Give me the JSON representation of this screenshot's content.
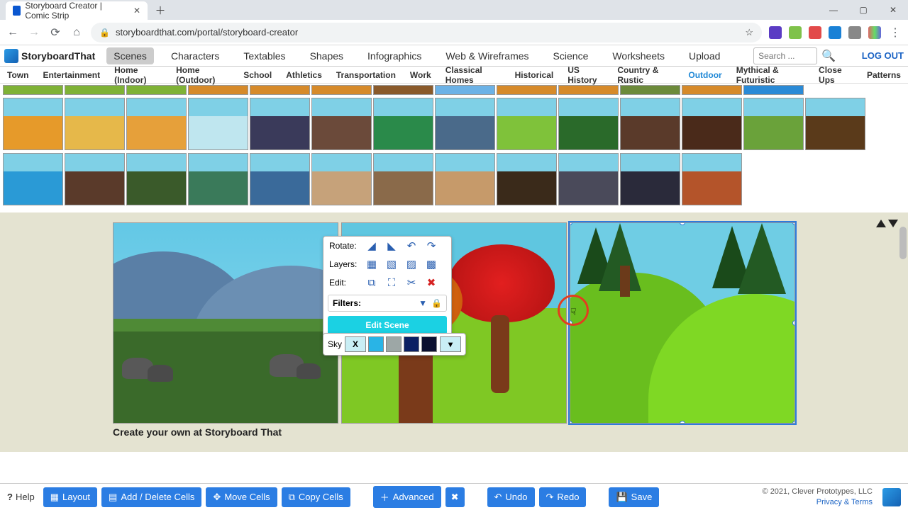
{
  "browser": {
    "tab_title": "Storyboard Creator | Comic Strip",
    "url": "storyboardthat.com/portal/storyboard-creator"
  },
  "header": {
    "logo_text": "StoryboardThat",
    "tabs": [
      "Scenes",
      "Characters",
      "Textables",
      "Shapes",
      "Infographics",
      "Web & Wireframes",
      "Science",
      "Worksheets",
      "Upload"
    ],
    "selected_tab": "Scenes",
    "search_placeholder": "Search ...",
    "logout": "LOG OUT"
  },
  "subtabs": {
    "items": [
      "Town",
      "Entertainment",
      "Home (Indoor)",
      "Home (Outdoor)",
      "School",
      "Athletics",
      "Transportation",
      "Work",
      "Classical Homes",
      "Historical",
      "US History",
      "Country & Rustic",
      "Outdoor",
      "Mythical & Futuristic",
      "Close Ups",
      "Patterns"
    ],
    "selected": "Outdoor"
  },
  "panel": {
    "rotate_label": "Rotate:",
    "layers_label": "Layers:",
    "edit_label": "Edit:",
    "filters_label": "Filters:",
    "edit_scene": "Edit Scene"
  },
  "sky_panel": {
    "label": "Sky",
    "selected_marker": "X",
    "swatches": [
      "#c9eef5",
      "#29b4e6",
      "#9da7a6",
      "#0b1f63",
      "#0b1030"
    ],
    "current": "#c9eef5"
  },
  "caption": "Create your own at Storyboard That",
  "toolbar": {
    "help": "Help",
    "layout": "Layout",
    "add_delete": "Add / Delete Cells",
    "move": "Move Cells",
    "copy": "Copy Cells",
    "advanced": "Advanced",
    "undo": "Undo",
    "redo": "Redo",
    "save": "Save"
  },
  "footer": {
    "copyright": "© 2021, Clever Prototypes, LLC",
    "privacy": "Privacy & Terms"
  },
  "thumb_colors": [
    [
      "#7fb236",
      "#7fb236",
      "#7fb236",
      "#d68a2a",
      "#d68a2a",
      "#d68a2a",
      "#8a5a2a",
      "#6cb2e6",
      "#d68a2a",
      "#d68a2a",
      "#6c8a3a",
      "#d68a2a",
      "#2a8ad6"
    ],
    [
      "#e69a2a",
      "#e6b84a",
      "#e6a03a",
      "#bfe6ef",
      "#3a3a5a",
      "#6b4a3a",
      "#2a8a4a",
      "#4a6a8a",
      "#7fc23a",
      "#2a6a2a",
      "#5a3a2a",
      "#4a2a1a",
      "#6aa23a",
      "#5a3a1a"
    ],
    [
      "#2a9ad6",
      "#5a3a2a",
      "#3a5a2a",
      "#3a7a5a",
      "#3a6a9a",
      "#c6a27a",
      "#8a6a4a",
      "#c69a6a",
      "#3a2a1a",
      "#4a4a5a",
      "#2a2a3a",
      "#b4542a"
    ]
  ]
}
